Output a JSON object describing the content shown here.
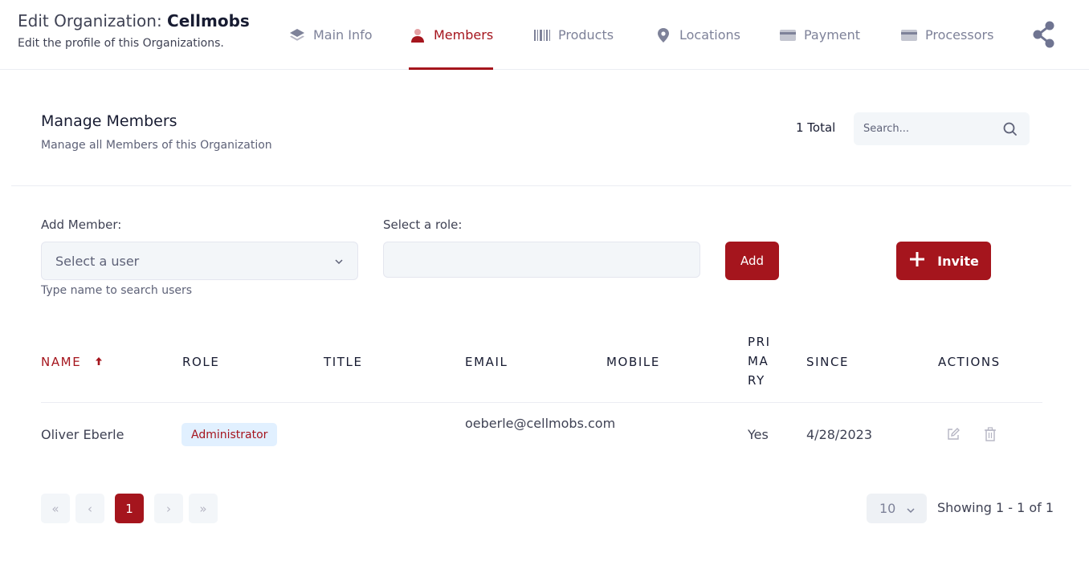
{
  "header": {
    "title_prefix": "Edit Organization:",
    "org_name": "Cellmobs",
    "subtitle": "Edit the profile of this Organizations.",
    "tabs": [
      {
        "label": "Main Info",
        "icon": "layers-icon"
      },
      {
        "label": "Members",
        "icon": "user-icon",
        "active": true
      },
      {
        "label": "Products",
        "icon": "barcode-icon"
      },
      {
        "label": "Locations",
        "icon": "map-pin-icon"
      },
      {
        "label": "Payment",
        "icon": "credit-card-icon"
      },
      {
        "label": "Processors",
        "icon": "credit-card-icon"
      }
    ],
    "share_icon": "share-icon"
  },
  "manage": {
    "title": "Manage Members",
    "subtitle": "Manage all Members of this Organization",
    "total": "1 Total",
    "search_placeholder": "Search..."
  },
  "add_form": {
    "add_member_label": "Add Member:",
    "select_user_placeholder": "Select a user",
    "hint": "Type name to search users",
    "select_role_label": "Select a role:",
    "role_value": "",
    "add_button": "Add",
    "invite_button": "Invite"
  },
  "table": {
    "columns": {
      "name": "NAME",
      "role": "ROLE",
      "title": "TITLE",
      "email": "EMAIL",
      "mobile": "MOBILE",
      "primary": "PRI MA RY",
      "since": "SINCE",
      "actions": "ACTIONS"
    },
    "sort": {
      "column": "name",
      "direction": "ascending"
    },
    "rows": [
      {
        "name": "Oliver Eberle",
        "role": "Administrator",
        "title": "",
        "email": "oeberle@cellmobs.com",
        "mobile": "",
        "primary": "Yes",
        "since": "4/28/2023"
      }
    ]
  },
  "pagination": {
    "first": "«",
    "prev": "‹",
    "current_page": "1",
    "next": "›",
    "last": "»",
    "page_size": "10",
    "showing": "Showing 1 - 1 of 1"
  },
  "colors": {
    "accent": "#a5151d",
    "muted": "#7e8299",
    "badge_bg": "#e1f0ff"
  }
}
